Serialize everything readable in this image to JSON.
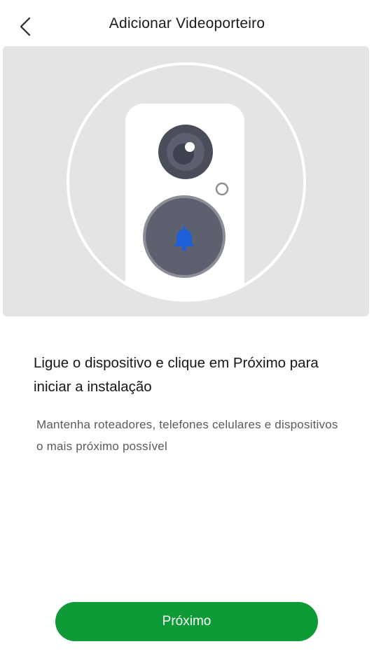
{
  "header": {
    "back_icon": "chevron-left-icon",
    "title": "Adicionar Videoporteiro"
  },
  "illustration": {
    "icons": [
      "doorbell-device-icon",
      "camera-lens-icon",
      "indicator-light-icon",
      "bell-icon"
    ],
    "colors": {
      "background": "#e3e4e6",
      "device_body": "#ffffff",
      "lens": "#4a4d5c",
      "button": "#5a5d6b",
      "bell": "#1e5fd8"
    }
  },
  "content": {
    "main_instruction": "Ligue o dispositivo e clique em Próximo para iniciar a instalação",
    "sub_instruction": "Mantenha roteadores, telefones celulares e dispositivos o mais próximo possível"
  },
  "footer": {
    "next_label": "Próximo",
    "accent_color": "#0e9a36"
  }
}
